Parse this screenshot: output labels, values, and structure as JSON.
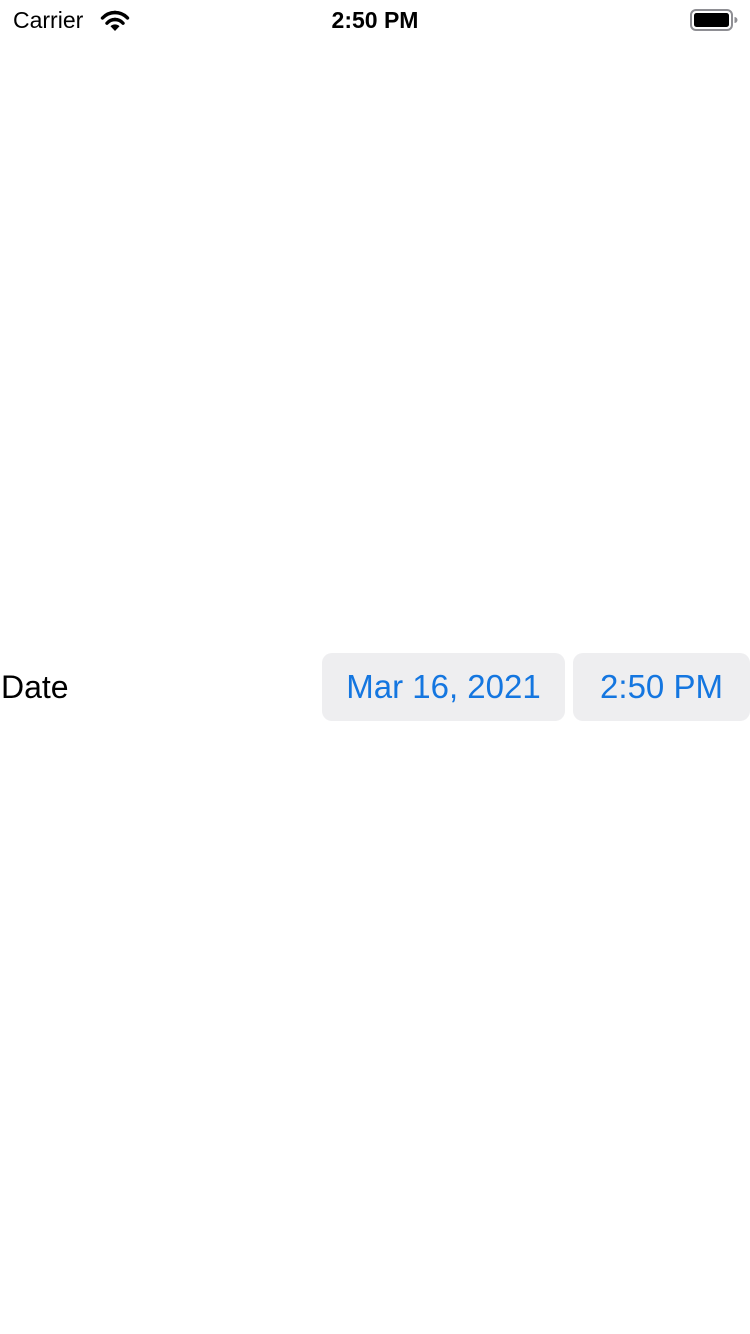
{
  "status_bar": {
    "carrier": "Carrier",
    "time": "2:50 PM",
    "wifi_icon": "wifi-icon",
    "battery_icon": "battery-full-icon"
  },
  "date_picker": {
    "label": "Date",
    "date_value": "Mar 16, 2021",
    "time_value": "2:50 PM",
    "accent_color": "#1476e0",
    "pill_background": "#eeeef0"
  }
}
